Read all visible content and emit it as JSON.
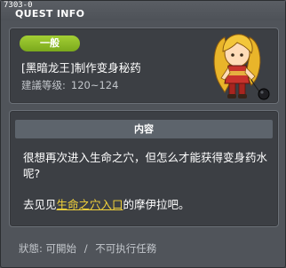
{
  "window": {
    "code": "7303-0",
    "title": "QUEST INFO"
  },
  "quest": {
    "category": "一般",
    "name": "[黑暗龙王]制作变身秘药",
    "level_label": "建議等级:",
    "level_range": "120~124"
  },
  "content": {
    "header": "内容",
    "line1": "很想再次进入生命之穴，但怎么才能获得变身药水呢?",
    "line2_pre": "去见见",
    "line2_link": "生命之穴入口",
    "line2_post": "的摩伊拉吧。"
  },
  "status": {
    "label": "狀態:",
    "value1": "可開始",
    "separator": "/",
    "value2": "不可执行任務"
  },
  "colors": {
    "badge": "#8dbd27",
    "link": "#f4d43a",
    "background": "#50545a"
  }
}
